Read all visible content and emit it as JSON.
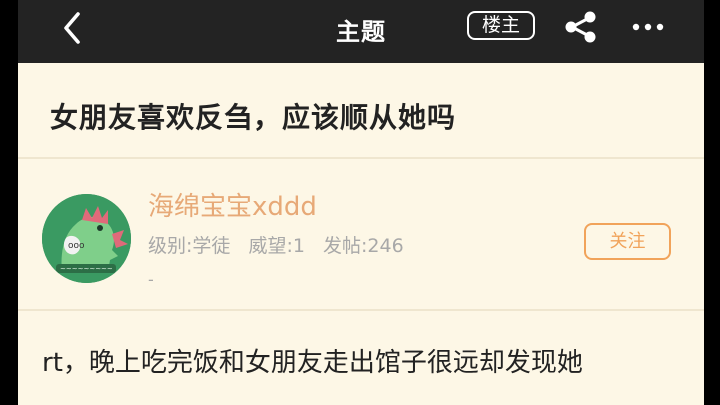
{
  "topbar": {
    "title": "主题",
    "owner_label": "楼主",
    "back_icon": "chevron-left-icon",
    "share_icon": "share-icon",
    "more_icon": "more-dots-icon"
  },
  "post": {
    "title": "女朋友喜欢反刍，应该顺从她吗",
    "body_line1": "rt，晚上吃完饭和女朋友走出馆子很远却发现她"
  },
  "author": {
    "name": "海绵宝宝xddd",
    "level": "级别:学徒",
    "prestige": "威望:1",
    "posts": "发帖:246",
    "signature": "-",
    "follow_label": "关注",
    "avatar_icon": "green-dinosaur-avatar"
  },
  "colors": {
    "topbar_bg": "#232323",
    "page_bg": "#fdf7e6",
    "author_name": "#e7a977",
    "follow_accent": "#f1a35a"
  }
}
